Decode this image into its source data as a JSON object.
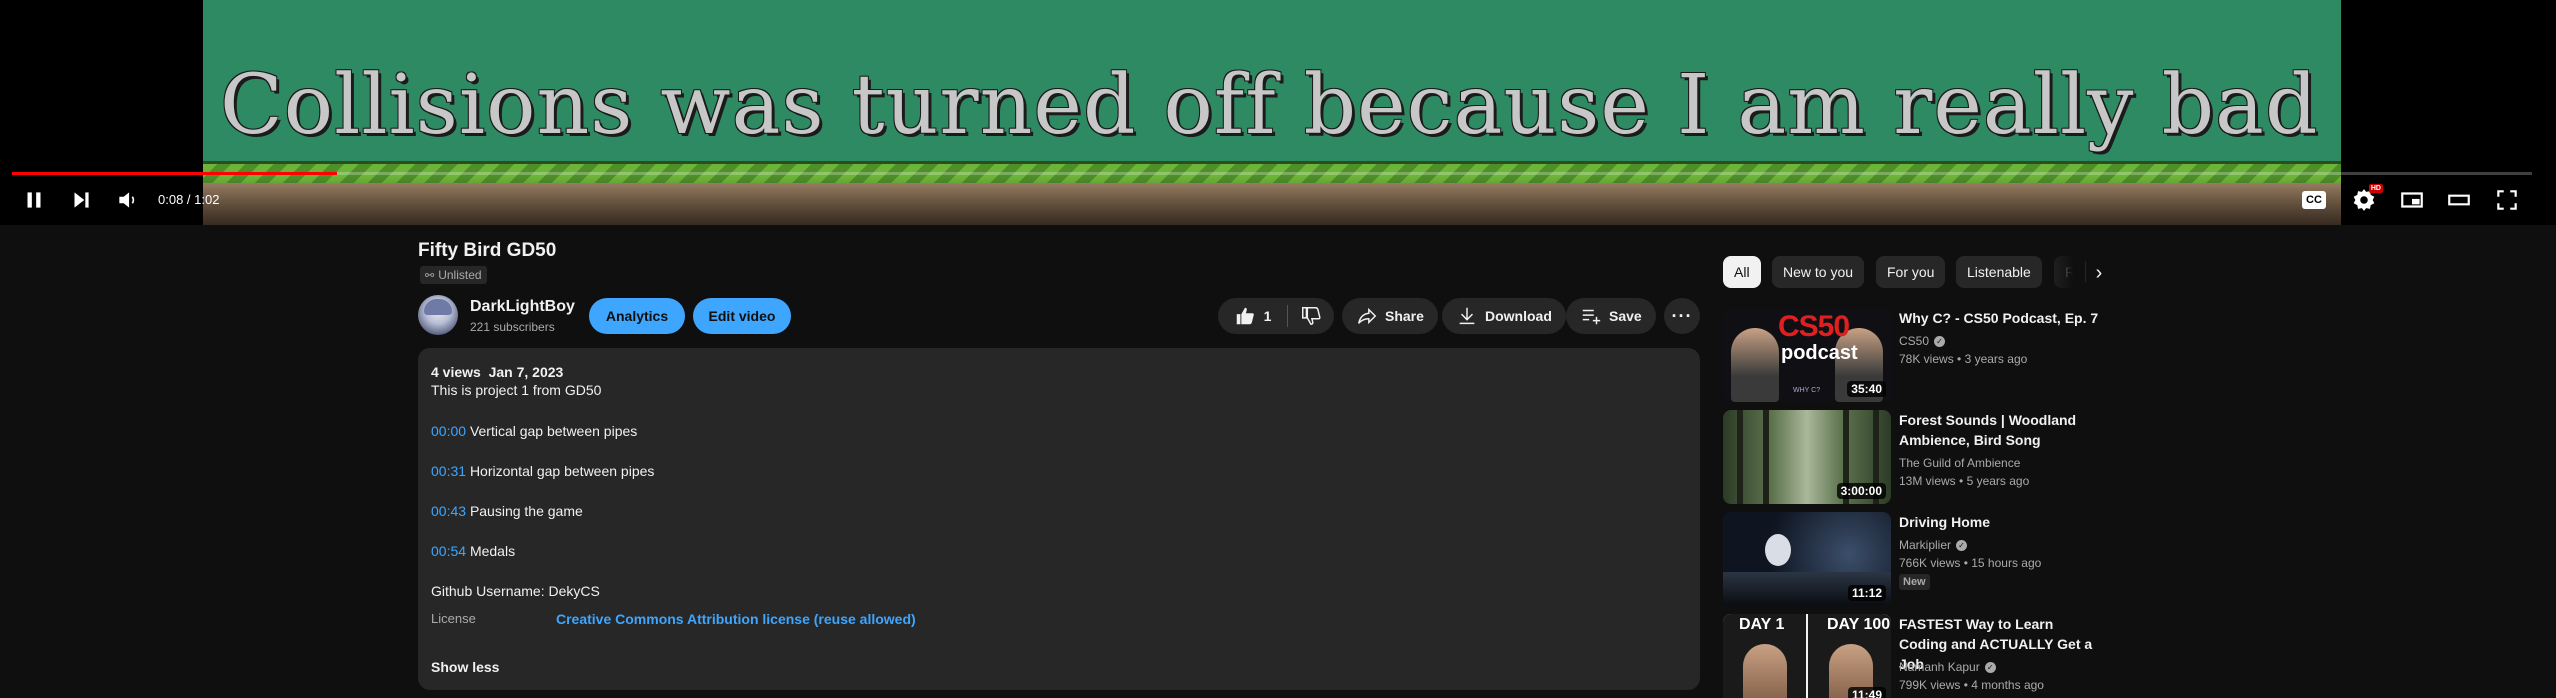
{
  "player": {
    "video_overlay_text": "Collisions was turned off because I am really bad",
    "current_time": "0:08",
    "duration": "1:02",
    "time_separator": " / ",
    "progress_fraction": 0.129,
    "icons": {
      "play_pause": "pause-icon",
      "next": "next-icon",
      "volume": "volume-icon",
      "captions": "cc-icon",
      "settings": "gear-icon",
      "miniplayer": "miniplayer-icon",
      "theater": "theater-icon",
      "fullscreen": "fullscreen-icon"
    },
    "cc_label": "CC",
    "hd_label": "HD",
    "accent_color": "#ff0000"
  },
  "video": {
    "title": "Fifty Bird GD50",
    "visibility": "Unlisted"
  },
  "channel": {
    "name": "DarkLightBoy",
    "subscribers": "221 subscribers"
  },
  "actions": {
    "analytics": "Analytics",
    "edit_video": "Edit video",
    "like_count": "1",
    "share": "Share",
    "download": "Download",
    "save": "Save",
    "more": "···"
  },
  "description": {
    "meta": "4 views  Jan 7, 2023",
    "intro": "This is project 1 from GD50",
    "chapters": [
      {
        "time": "00:00",
        "text": "Vertical gap between pipes"
      },
      {
        "time": "00:31",
        "text": "Horizontal gap between pipes"
      },
      {
        "time": "00:43",
        "text": "Pausing the game"
      },
      {
        "time": "00:54",
        "text": "Medals"
      }
    ],
    "github": "Github Username: DekyCS",
    "license_label": "License",
    "license_value": "Creative Commons Attribution license (reuse allowed)",
    "show_less": "Show less",
    "link_color": "#3ea6ff"
  },
  "chips": [
    "All",
    "New to you",
    "For you",
    "Listenable",
    "R"
  ],
  "recommendations": [
    {
      "title": "Why C? - CS50 Podcast, Ep. 7",
      "channel": "CS50",
      "verified": true,
      "views": "78K views",
      "age": "3 years ago",
      "duration": "35:40",
      "thumb_text_1": "CS50",
      "thumb_text_2": "podcast",
      "thumb_text_3": "WHY C?"
    },
    {
      "title": "Forest Sounds | Woodland Ambience, Bird Song",
      "channel": "The Guild of Ambience",
      "verified": false,
      "views": "13M views",
      "age": "5 years ago",
      "duration": "3:00:00"
    },
    {
      "title": "Driving Home",
      "channel": "Markiplier",
      "verified": true,
      "views": "766K views",
      "age": "15 hours ago",
      "duration": "11:12",
      "badge": "New"
    },
    {
      "title": "FASTEST Way to Learn Coding and ACTUALLY Get a Job",
      "channel": "Namanh Kapur",
      "verified": true,
      "views": "799K views",
      "age": "4 months ago",
      "duration": "11:49",
      "thumb_text_1": "DAY 1",
      "thumb_text_2": "DAY 100"
    }
  ],
  "meta_separator": " • "
}
